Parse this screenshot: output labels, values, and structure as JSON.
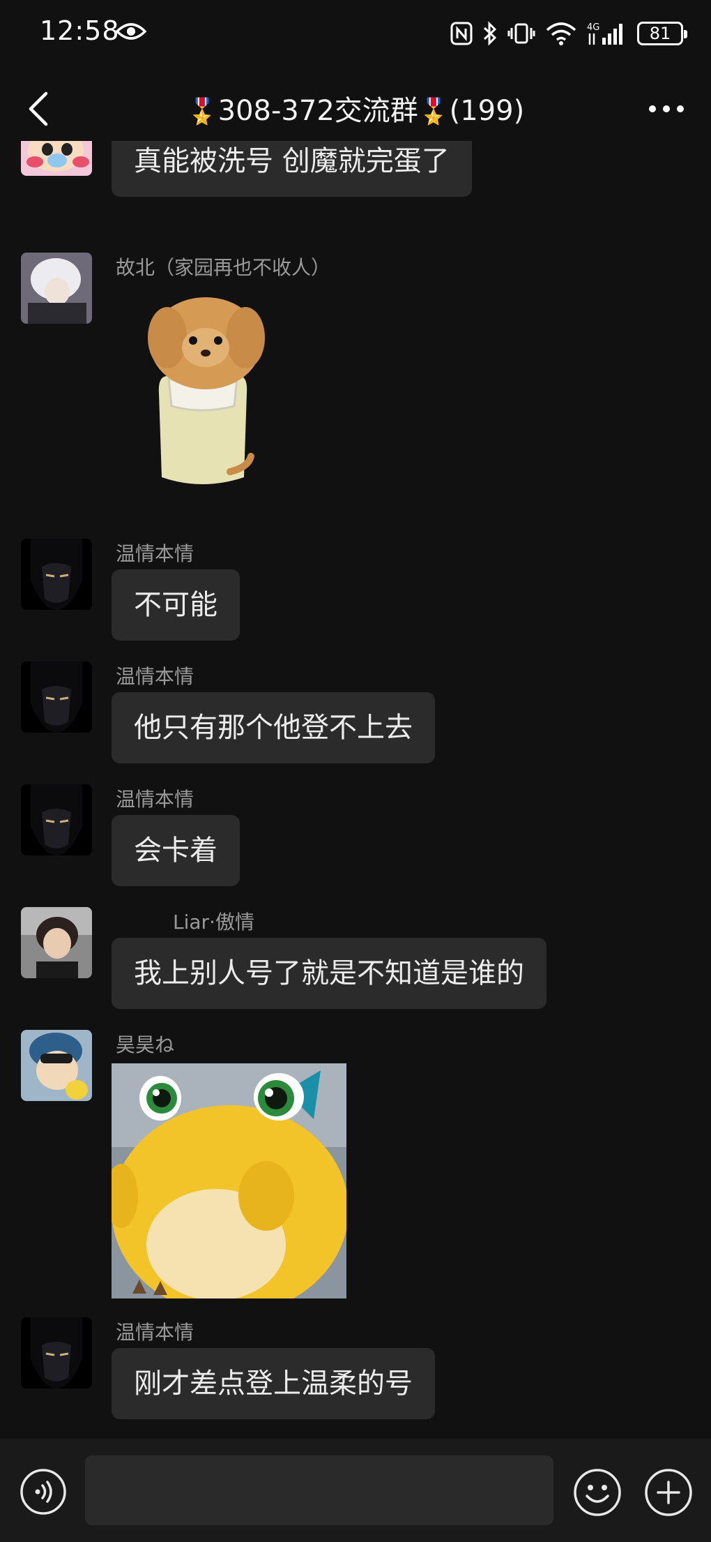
{
  "status_bar": {
    "time": "12:58",
    "network": "4G",
    "battery": "81"
  },
  "header": {
    "title": "308-372交流群",
    "member_count": "(199)",
    "medal": "🎖️"
  },
  "messages": [
    {
      "sender": "",
      "text": "真能被洗号 创魔就完蛋了"
    },
    {
      "sender": "故北（家园再也不收人）",
      "type": "sticker"
    },
    {
      "sender": "温情本情",
      "text": "不可能"
    },
    {
      "sender": "温情本情",
      "text": "他只有那个他登不上去"
    },
    {
      "sender": "温情本情",
      "text": "会卡着"
    },
    {
      "sender": "Liar·傲情",
      "text": "我上别人号了就是不知道是谁的"
    },
    {
      "sender": "昊昊ね",
      "type": "sticker"
    },
    {
      "sender": "温情本情",
      "text": "刚才差点登上温柔的号"
    }
  ],
  "input": {
    "value": ""
  },
  "icons": {
    "status": [
      "eye-icon",
      "nfc-icon",
      "bluetooth-icon",
      "vibrate-icon",
      "wifi-icon",
      "signal-icon",
      "battery-icon"
    ],
    "header": [
      "back-icon",
      "more-icon"
    ],
    "input_bar": [
      "voice-icon",
      "emoji-icon",
      "plus-icon"
    ]
  }
}
